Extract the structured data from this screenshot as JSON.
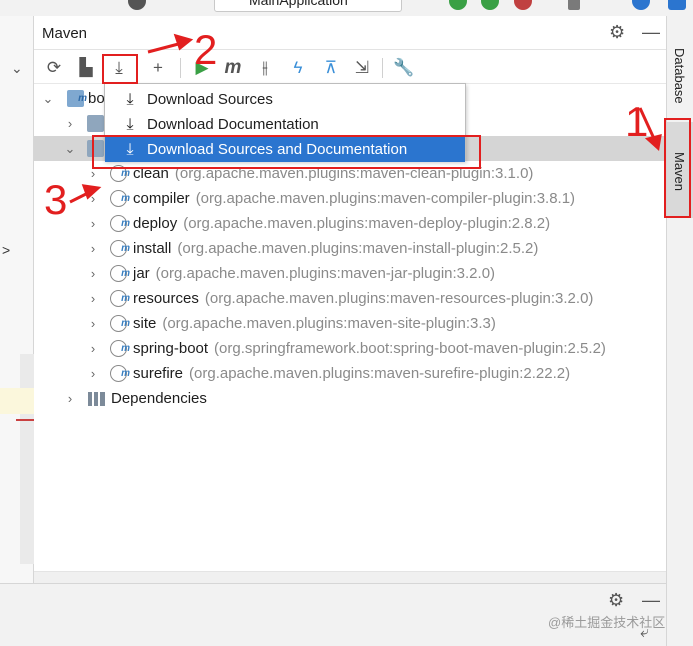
{
  "top_toolbar": {
    "run_config": "MainApplication"
  },
  "panel": {
    "title": "Maven",
    "header_icons": [
      "gear-icon",
      "minimize-icon"
    ]
  },
  "toolbar": {
    "buttons": [
      {
        "name": "reload-icon",
        "glyph": "⟳"
      },
      {
        "name": "generate-sources-icon",
        "glyph": "▙"
      },
      {
        "name": "download-icon",
        "glyph": "⤓"
      },
      {
        "name": "add-icon",
        "glyph": "+"
      },
      {
        "name": "run-icon",
        "glyph": "▶"
      },
      {
        "name": "execute-goal-icon",
        "glyph": "m"
      },
      {
        "name": "toggle-offline-icon",
        "glyph": "⫲"
      },
      {
        "name": "skip-tests-icon",
        "glyph": "ϟ"
      },
      {
        "name": "show-dependencies-icon",
        "glyph": "⊼"
      },
      {
        "name": "collapse-all-icon",
        "glyph": "⇲"
      },
      {
        "name": "settings-wrench-icon",
        "glyph": "🔧"
      }
    ]
  },
  "dropdown": {
    "items": [
      {
        "label": "Download Sources",
        "active": false
      },
      {
        "label": "Download Documentation",
        "active": false
      },
      {
        "label": "Download Sources and Documentation",
        "active": true
      }
    ]
  },
  "tree": {
    "root_label": "bo",
    "plugins": [
      {
        "name": "clean",
        "gav": "(org.apache.maven.plugins:maven-clean-plugin:3.1.0)"
      },
      {
        "name": "compiler",
        "gav": "(org.apache.maven.plugins:maven-compiler-plugin:3.8.1)"
      },
      {
        "name": "deploy",
        "gav": "(org.apache.maven.plugins:maven-deploy-plugin:2.8.2)"
      },
      {
        "name": "install",
        "gav": "(org.apache.maven.plugins:maven-install-plugin:2.5.2)"
      },
      {
        "name": "jar",
        "gav": "(org.apache.maven.plugins:maven-jar-plugin:3.2.0)"
      },
      {
        "name": "resources",
        "gav": "(org.apache.maven.plugins:maven-resources-plugin:3.2.0)"
      },
      {
        "name": "site",
        "gav": "(org.apache.maven.plugins:maven-site-plugin:3.3)"
      },
      {
        "name": "spring-boot",
        "gav": "(org.springframework.boot:spring-boot-maven-plugin:2.5.2)"
      },
      {
        "name": "surefire",
        "gav": "(org.apache.maven.plugins:maven-surefire-plugin:2.22.2)"
      }
    ],
    "dependencies_label": "Dependencies"
  },
  "right_tabs": {
    "database": "Database",
    "maven": "Maven"
  },
  "annotations": {
    "one": "1",
    "two": "2",
    "three": "3",
    "color": "#e21f1f"
  },
  "watermark": "@稀土掘金技术社区"
}
